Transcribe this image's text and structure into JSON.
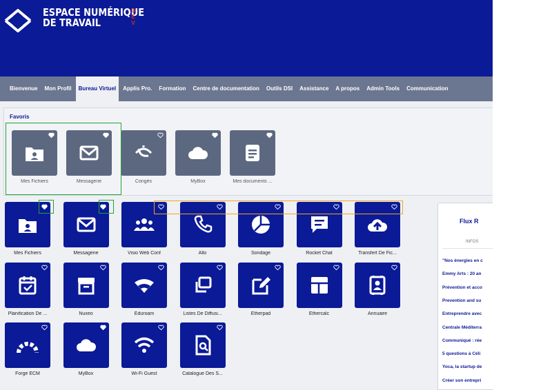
{
  "header": {
    "brand_line1": "ESPACE NUMÉRIQUE",
    "brand_line2": "DE TRAVAIL",
    "env_badge": [
      "D",
      "E",
      "V"
    ]
  },
  "nav": {
    "items": [
      "Bienvenue",
      "Mon Profil",
      "Bureau Virtuel",
      "Applis Pro.",
      "Formation",
      "Centre de documentation",
      "Outils DSI",
      "Assistance",
      "A propos",
      "Admin Tools",
      "Communication"
    ],
    "active": "Bureau Virtuel"
  },
  "favorites": {
    "title": "Favoris",
    "items": [
      {
        "label": "Mes Fichiers",
        "icon": "folder-user-icon",
        "favorite": true
      },
      {
        "label": "Messagerie",
        "icon": "mail-icon",
        "favorite": true
      },
      {
        "label": "Congés",
        "icon": "beach-umbrella-icon",
        "favorite": false
      },
      {
        "label": "MyBox",
        "icon": "cloud-icon",
        "favorite": true
      },
      {
        "label": "Mes documents ...",
        "icon": "document-icon",
        "favorite": true
      }
    ]
  },
  "apps": {
    "items": [
      {
        "label": "Mes Fichiers",
        "icon": "folder-user-icon",
        "favorite": true
      },
      {
        "label": "Messagerie",
        "icon": "mail-icon",
        "favorite": true
      },
      {
        "label": "Visio Web Conf",
        "icon": "group-icon",
        "favorite": false
      },
      {
        "label": "Allo",
        "icon": "phone-icon",
        "favorite": false
      },
      {
        "label": "Sondage",
        "icon": "pie-chart-icon",
        "favorite": false
      },
      {
        "label": "Rocket Chat",
        "icon": "chat-icon",
        "favorite": false
      },
      {
        "label": "Transfert De Fic...",
        "icon": "cloud-upload-icon",
        "favorite": false
      },
      {
        "label": "Planification De ...",
        "icon": "calendar-check-icon",
        "favorite": false
      },
      {
        "label": "Nuxeo",
        "icon": "archive-box-icon",
        "favorite": false
      },
      {
        "label": "Eduroam",
        "icon": "wifi-sector-icon",
        "favorite": false
      },
      {
        "label": "Listes De Diffusi...",
        "icon": "copy-icon",
        "favorite": false
      },
      {
        "label": "Etherpad",
        "icon": "edit-icon",
        "favorite": false
      },
      {
        "label": "Ethercalc",
        "icon": "calc-grid-icon",
        "favorite": false
      },
      {
        "label": "Annuaire",
        "icon": "contact-book-icon",
        "favorite": false
      },
      {
        "label": "Forge ECM",
        "icon": "rainbow-icon",
        "favorite": false
      },
      {
        "label": "MyBox",
        "icon": "cloud-icon",
        "favorite": true
      },
      {
        "label": "Wi-Fi Guest",
        "icon": "wifi-icon",
        "favorite": false
      },
      {
        "label": "Catalogue Des S...",
        "icon": "file-search-icon",
        "favorite": false
      }
    ]
  },
  "flux": {
    "title": "Flux R",
    "tab": "INFOS",
    "items": [
      "\"Nos énergies en c",
      "Emmy Arts : 20 an",
      "Prévention et acco",
      "Prevention and su",
      "Entreprendre avec",
      "Centrale Méditerra",
      "Communiqué : rée",
      "5 questions à Céli",
      "Yoca, la startup de",
      "Créer son entrepri"
    ]
  },
  "colors": {
    "primary": "#0b1a96",
    "nav_bg": "#6b7690",
    "fav_tile": "#5c6880",
    "highlight_green": "#22a33a",
    "highlight_orange": "#f4a51f",
    "dev_red": "#e2271f"
  }
}
